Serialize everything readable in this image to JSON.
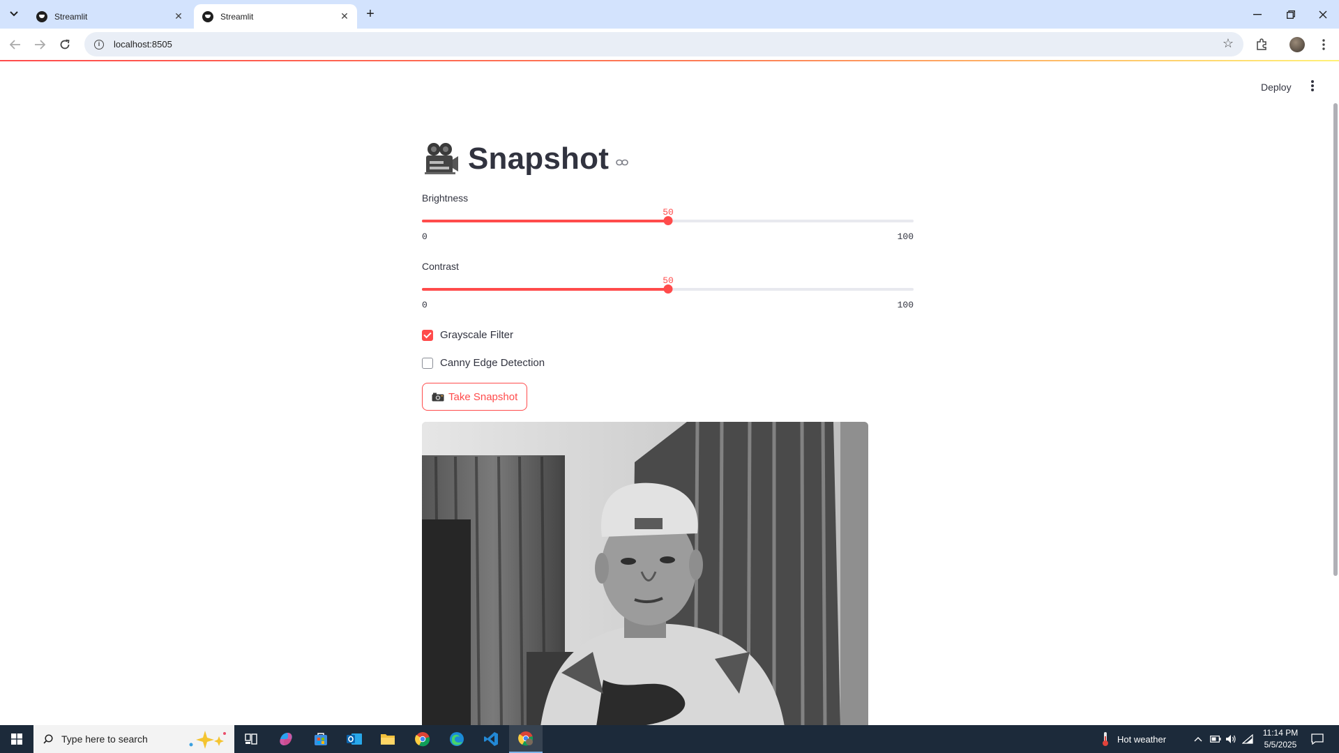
{
  "browser": {
    "tabs": [
      {
        "title": "Streamlit",
        "active": false
      },
      {
        "title": "Streamlit",
        "active": true
      }
    ],
    "url": "localhost:8505"
  },
  "header": {
    "deploy_label": "Deploy"
  },
  "page": {
    "title": "Snapshot",
    "title_icon": "movie-camera-icon",
    "sliders": [
      {
        "label": "Brightness",
        "value": "50",
        "min": "0",
        "max": "100",
        "fraction": 0.5
      },
      {
        "label": "Contrast",
        "value": "50",
        "min": "0",
        "max": "100",
        "fraction": 0.5
      }
    ],
    "checkboxes": [
      {
        "label": "Grayscale Filter",
        "checked": true
      },
      {
        "label": "Canny Edge Detection",
        "checked": false
      }
    ],
    "button_label": "Take Snapshot",
    "image": "grayscale webcam snapshot"
  },
  "taskbar": {
    "search_placeholder": "Type here to search",
    "weather": "Hot weather",
    "time": "11:14 PM",
    "date": "5/5/2025"
  },
  "colors": {
    "accent": "#ff4b4b",
    "text": "#31333f",
    "tabbar": "#d3e3fd",
    "taskbar": "#1c2a3a"
  }
}
